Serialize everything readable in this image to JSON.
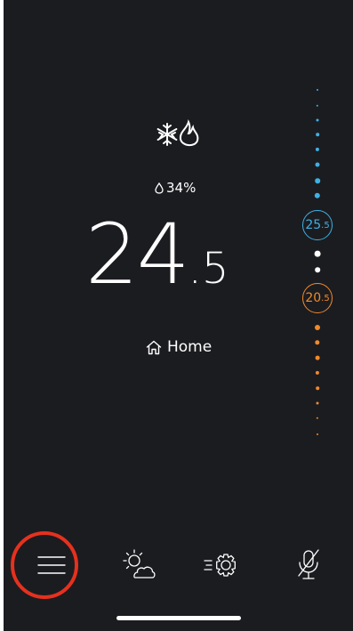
{
  "mode": {
    "icon": "snowflake-flame-icon"
  },
  "humidity": {
    "icon": "droplet-icon",
    "value": "34%"
  },
  "temperature": {
    "integer": "24",
    "decimal": ".5"
  },
  "location": {
    "icon": "home-icon",
    "label": "Home"
  },
  "setpoints": {
    "cool": {
      "integer": "25",
      "decimal": ".5",
      "color": "#3fb0e4"
    },
    "heat": {
      "integer": "20",
      "decimal": ".5",
      "color": "#f08a2b"
    }
  },
  "tabbar": {
    "items": [
      {
        "name": "menu",
        "icon": "hamburger-menu-icon",
        "highlighted": true
      },
      {
        "name": "weather",
        "icon": "sun-cloud-icon"
      },
      {
        "name": "settings",
        "icon": "gear-icon"
      },
      {
        "name": "voice",
        "icon": "microphone-muted-icon"
      }
    ]
  },
  "colors": {
    "background": "#1b1c20",
    "cool": "#3fb0e4",
    "heat": "#f08a2b",
    "highlight": "#e5311e"
  }
}
